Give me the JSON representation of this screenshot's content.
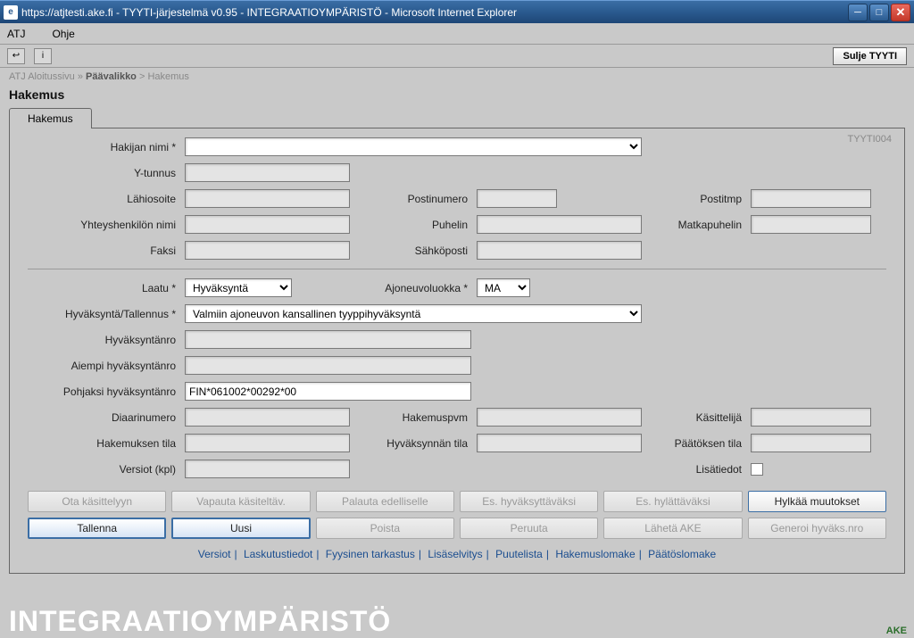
{
  "window": {
    "title": "https://atjtesti.ake.fi - TYYTI-järjestelmä v0.95 - INTEGRAATIOYMPÄRISTÖ - Microsoft Internet Explorer"
  },
  "menu": {
    "item1": "ATJ",
    "item2": "Ohje"
  },
  "toolbar": {
    "close_label": "Sulje TYYTI"
  },
  "breadcrumb": {
    "p1": "ATJ Aloitussivu",
    "sep1": "»",
    "p2": "Päävalikko",
    "sep2": ">",
    "p3": "Hakemus"
  },
  "page": {
    "title": "Hakemus",
    "tab": "Hakemus",
    "code": "TYYTI004"
  },
  "labels": {
    "hakijan_nimi": "Hakijan nimi *",
    "y_tunnus": "Y-tunnus",
    "lahiosoite": "Lähiosoite",
    "postinumero": "Postinumero",
    "postitmp": "Postitmp",
    "yhteyshenkilon_nimi": "Yhteyshenkilön nimi",
    "puhelin": "Puhelin",
    "matkapuhelin": "Matkapuhelin",
    "faksi": "Faksi",
    "sahkoposti": "Sähköposti",
    "laatu": "Laatu *",
    "ajoneuvoluokka": "Ajoneuvoluokka *",
    "hyvaksynta_tallennus": "Hyväksyntä/Tallennus *",
    "hyvaksyntanro": "Hyväksyntänro",
    "aiempi_hyvaksyntanro": "Aiempi hyväksyntänro",
    "pohjaksi_hyvaksyntanro": "Pohjaksi hyväksyntänro",
    "diaarinumero": "Diaarinumero",
    "hakemuspvm": "Hakemuspvm",
    "kasittelija": "Käsittelijä",
    "hakemuksen_tila": "Hakemuksen tila",
    "hyvaksynnan_tila": "Hyväksynnän tila",
    "paatoksen_tila": "Päätöksen tila",
    "versiot_kpl": "Versiot (kpl)",
    "lisatiedot": "Lisätiedot"
  },
  "values": {
    "hakijan_nimi": "",
    "y_tunnus": "",
    "lahiosoite": "",
    "postinumero": "",
    "postitmp": "",
    "yhteyshenkilon_nimi": "",
    "puhelin": "",
    "matkapuhelin": "",
    "faksi": "",
    "sahkoposti": "",
    "laatu": "Hyväksyntä",
    "ajoneuvoluokka": "MA",
    "hyvaksynta_tallennus": "Valmiin ajoneuvon kansallinen tyyppihyväksyntä",
    "hyvaksyntanro": "",
    "aiempi_hyvaksyntanro": "",
    "pohjaksi_hyvaksyntanro": "FIN*061002*00292*00",
    "diaarinumero": "",
    "hakemuspvm": "",
    "kasittelija": "",
    "hakemuksen_tila": "",
    "hyvaksynnan_tila": "",
    "paatoksen_tila": "",
    "versiot_kpl": ""
  },
  "buttons": {
    "ota_kasittelyyn": "Ota käsittelyyn",
    "vapauta": "Vapauta käsiteltäv.",
    "palauta": "Palauta edelliselle",
    "es_hyv": "Es. hyväksyttäväksi",
    "es_hyl": "Es. hylättäväksi",
    "hylkaa": "Hylkää muutokset",
    "tallenna": "Tallenna",
    "uusi": "Uusi",
    "poista": "Poista",
    "peruuta": "Peruuta",
    "laheta_ake": "Lähetä AKE",
    "generoi": "Generoi hyväks.nro"
  },
  "links": {
    "versiot": "Versiot",
    "laskutustiedot": "Laskutustiedot",
    "fyysinen": "Fyysinen tarkastus",
    "lisaselvitys": "Lisäselvitys",
    "puutelista": "Puutelista",
    "hakemuslomake": "Hakemuslomake",
    "paatoslomake": "Päätöslomake"
  },
  "footer": {
    "brand": "INTEGRAATIOYMPÄRISTÖ",
    "right": "AKE"
  }
}
